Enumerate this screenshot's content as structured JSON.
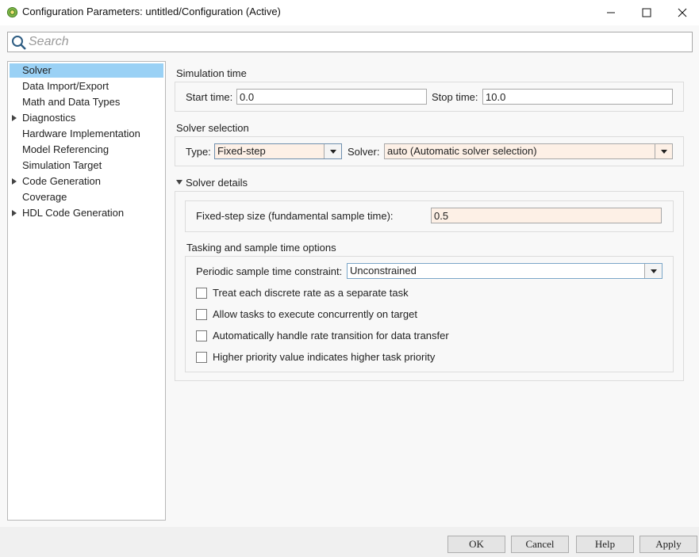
{
  "window": {
    "title": "Configuration Parameters: untitled/Configuration (Active)"
  },
  "search": {
    "placeholder": "Search"
  },
  "tree": [
    {
      "label": "Solver",
      "selected": true,
      "expandable": false
    },
    {
      "label": "Data Import/Export",
      "selected": false,
      "expandable": false
    },
    {
      "label": "Math and Data Types",
      "selected": false,
      "expandable": false
    },
    {
      "label": "Diagnostics",
      "selected": false,
      "expandable": true
    },
    {
      "label": "Hardware Implementation",
      "selected": false,
      "expandable": false
    },
    {
      "label": "Model Referencing",
      "selected": false,
      "expandable": false
    },
    {
      "label": "Simulation Target",
      "selected": false,
      "expandable": false
    },
    {
      "label": "Code Generation",
      "selected": false,
      "expandable": true
    },
    {
      "label": "Coverage",
      "selected": false,
      "expandable": false
    },
    {
      "label": "HDL Code Generation",
      "selected": false,
      "expandable": true
    }
  ],
  "simulation_time": {
    "title": "Simulation time",
    "start_label": "Start time:",
    "start_value": "0.0",
    "stop_label": "Stop time:",
    "stop_value": "10.0"
  },
  "solver_selection": {
    "title": "Solver selection",
    "type_label": "Type:",
    "type_value": "Fixed-step",
    "solver_label": "Solver:",
    "solver_value": "auto (Automatic solver selection)"
  },
  "solver_details": {
    "title": "Solver details",
    "step_size_label": "Fixed-step size (fundamental sample time):",
    "step_size_value": "0.5"
  },
  "tasking": {
    "title": "Tasking and sample time options",
    "constraint_label": "Periodic sample time constraint:",
    "constraint_value": "Unconstrained",
    "checkboxes": [
      {
        "label": "Treat each discrete rate as a separate task",
        "checked": false
      },
      {
        "label": "Allow tasks to execute concurrently on target",
        "checked": false
      },
      {
        "label": "Automatically handle rate transition for data transfer",
        "checked": false
      },
      {
        "label": "Higher priority value indicates higher task priority",
        "checked": false
      }
    ]
  },
  "buttons": {
    "ok": "OK",
    "cancel": "Cancel",
    "help": "Help",
    "apply": "Apply"
  },
  "colors": {
    "selection": "#9ad1f5",
    "tinted_field": "#fdf0e6"
  }
}
